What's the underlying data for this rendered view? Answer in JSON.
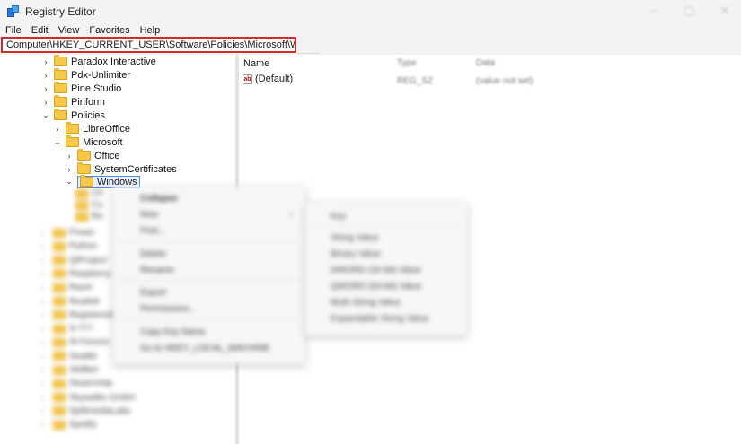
{
  "window": {
    "title": "Registry Editor",
    "controls": [
      "–",
      "▢",
      "✕"
    ]
  },
  "menu": [
    "File",
    "Edit",
    "View",
    "Favorites",
    "Help"
  ],
  "address": "Computer\\HKEY_CURRENT_USER\\Software\\Policies\\Microsoft\\Windows",
  "tree": {
    "rows": [
      {
        "label": "Paradox Interactive",
        "chev": "›"
      },
      {
        "label": "Pdx-Unlimiter",
        "chev": "›"
      },
      {
        "label": "Pine Studio",
        "chev": "›"
      },
      {
        "label": "Piriform",
        "chev": "›"
      },
      {
        "label": "Policies",
        "chev": "⌄"
      },
      {
        "label": "LibreOffice",
        "chev": "›"
      },
      {
        "label": "Microsoft",
        "chev": "⌄"
      },
      {
        "label": "Office",
        "chev": "›"
      },
      {
        "label": "SystemCertificates",
        "chev": "›"
      },
      {
        "label": "Windows",
        "chev": "⌄"
      }
    ],
    "blurred_rows": [
      "Ch",
      "Cu",
      "Re",
      "Power",
      "Python",
      "QtProject",
      "Raspberry Pi",
      "Razer",
      "Realtek",
      "RegisteredA",
      "S-777",
      "Sl Fences",
      "Seattle",
      "Skillbet",
      "SteamVoip",
      "Skywalks GmbH",
      "SplitmediaLabs",
      "Spotify"
    ]
  },
  "values": {
    "columns": {
      "name": "Name",
      "type": "Type",
      "data": "Data"
    },
    "rows": [
      {
        "name": "(Default)",
        "type": "REG_SZ",
        "data": "(value not set)"
      }
    ]
  },
  "context_menu": {
    "items": [
      "Collapse",
      "New",
      "Find...",
      "Delete",
      "Rename",
      "Export",
      "Permissions...",
      "Copy Key Name",
      "Go to HKEY_LOCAL_MACHINE"
    ],
    "new_arrow": "›",
    "submenu": [
      "Key",
      "String Value",
      "Binary Value",
      "DWORD (32-bit) Value",
      "QWORD (64-bit) Value",
      "Multi-String Value",
      "Expandable String Value"
    ]
  }
}
